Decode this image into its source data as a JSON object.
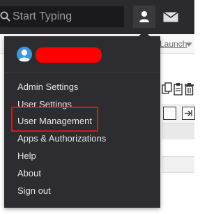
{
  "header": {
    "search_placeholder": "Start Typing",
    "icons": {
      "search": "search-icon",
      "user": "user-icon",
      "mail": "mail-icon"
    }
  },
  "background": {
    "launch_link": "Launch"
  },
  "dropdown": {
    "user_name_redacted": true,
    "items": [
      {
        "label": "Admin Settings"
      },
      {
        "label": "User Settings"
      },
      {
        "label": "User Management"
      },
      {
        "label": "Apps & Authorizations"
      },
      {
        "label": "Help"
      },
      {
        "label": "About"
      },
      {
        "label": "Sign out"
      }
    ],
    "highlighted_item": "User Management"
  },
  "colors": {
    "topbar": "#2b2b2e",
    "menu_bg": "#2d2d31",
    "menu_text": "#e6e6e6",
    "avatar": "#3f97d6",
    "redaction": "#ff0000",
    "highlight": "#e0111d"
  }
}
